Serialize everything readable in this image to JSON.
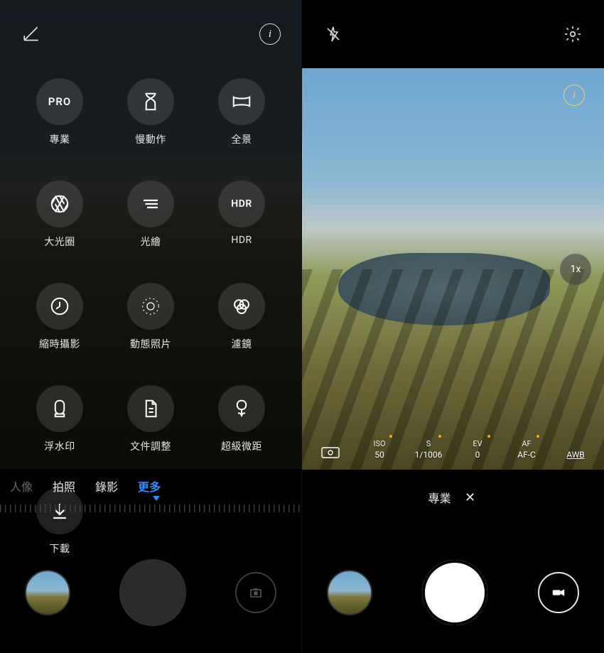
{
  "left": {
    "topbar": {
      "edit": "edit",
      "info": "i"
    },
    "modes": [
      {
        "icon": "pro",
        "label": "專業"
      },
      {
        "icon": "hourglass",
        "label": "慢動作"
      },
      {
        "icon": "panorama",
        "label": "全景"
      },
      {
        "icon": "aperture",
        "label": "大光圈"
      },
      {
        "icon": "light",
        "label": "光繪"
      },
      {
        "icon": "hdr",
        "label": "HDR"
      },
      {
        "icon": "timelapse",
        "label": "縮時攝影"
      },
      {
        "icon": "motion",
        "label": "動態照片"
      },
      {
        "icon": "filter",
        "label": "濾鏡"
      },
      {
        "icon": "watermark",
        "label": "浮水印"
      },
      {
        "icon": "document",
        "label": "文件調整"
      },
      {
        "icon": "macro",
        "label": "超級微距"
      },
      {
        "icon": "download",
        "label": "下載"
      }
    ],
    "tabs": [
      {
        "label": "人像",
        "state": "dim"
      },
      {
        "label": "拍照",
        "state": "normal"
      },
      {
        "label": "錄影",
        "state": "normal"
      },
      {
        "label": "更多",
        "state": "active"
      }
    ]
  },
  "right": {
    "topbar": {
      "flash": "off",
      "settings": "settings"
    },
    "info": "i",
    "zoom": "1x",
    "pro_controls": {
      "metering": "[O]",
      "iso": {
        "label": "ISO",
        "value": "50"
      },
      "s": {
        "label": "S",
        "value": "1/1006"
      },
      "ev": {
        "label": "EV",
        "value": "0"
      },
      "af": {
        "label": "AF",
        "value": "AF-C"
      },
      "awb": {
        "label": "",
        "value": "AWB"
      }
    },
    "mode_label": "專業",
    "close": "✕"
  }
}
